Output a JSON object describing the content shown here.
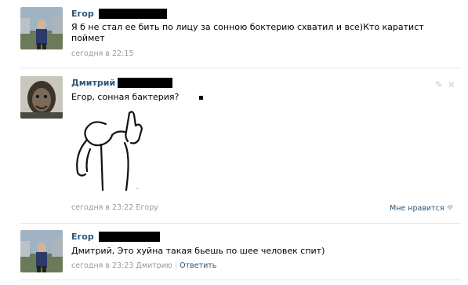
{
  "comments": [
    {
      "author_first": "Егор",
      "text": "Я б не стал ее бить по лицу за сонною боктерию схватил и все)Кто каратист поймет",
      "time": "сегодня в 22:15"
    },
    {
      "author_first": "Дмитрий",
      "text": "Егор, сонная бактерия?",
      "time": "сегодня в 23:22 Егору",
      "like_label": "Мне нравится",
      "has_image": true
    },
    {
      "author_first": "Егор",
      "text": "Дмитрий, Это хуйна такая бьешь по шее человек спит)",
      "time": "сегодня в 23:23 Дмитрию",
      "reply_label": "Ответить"
    }
  ],
  "icons": {
    "edit": "pencil-icon",
    "delete": "close-icon",
    "like": "heart-icon"
  },
  "colors": {
    "link": "#2b587a",
    "meta": "#999999",
    "divider": "#e7eaed"
  }
}
